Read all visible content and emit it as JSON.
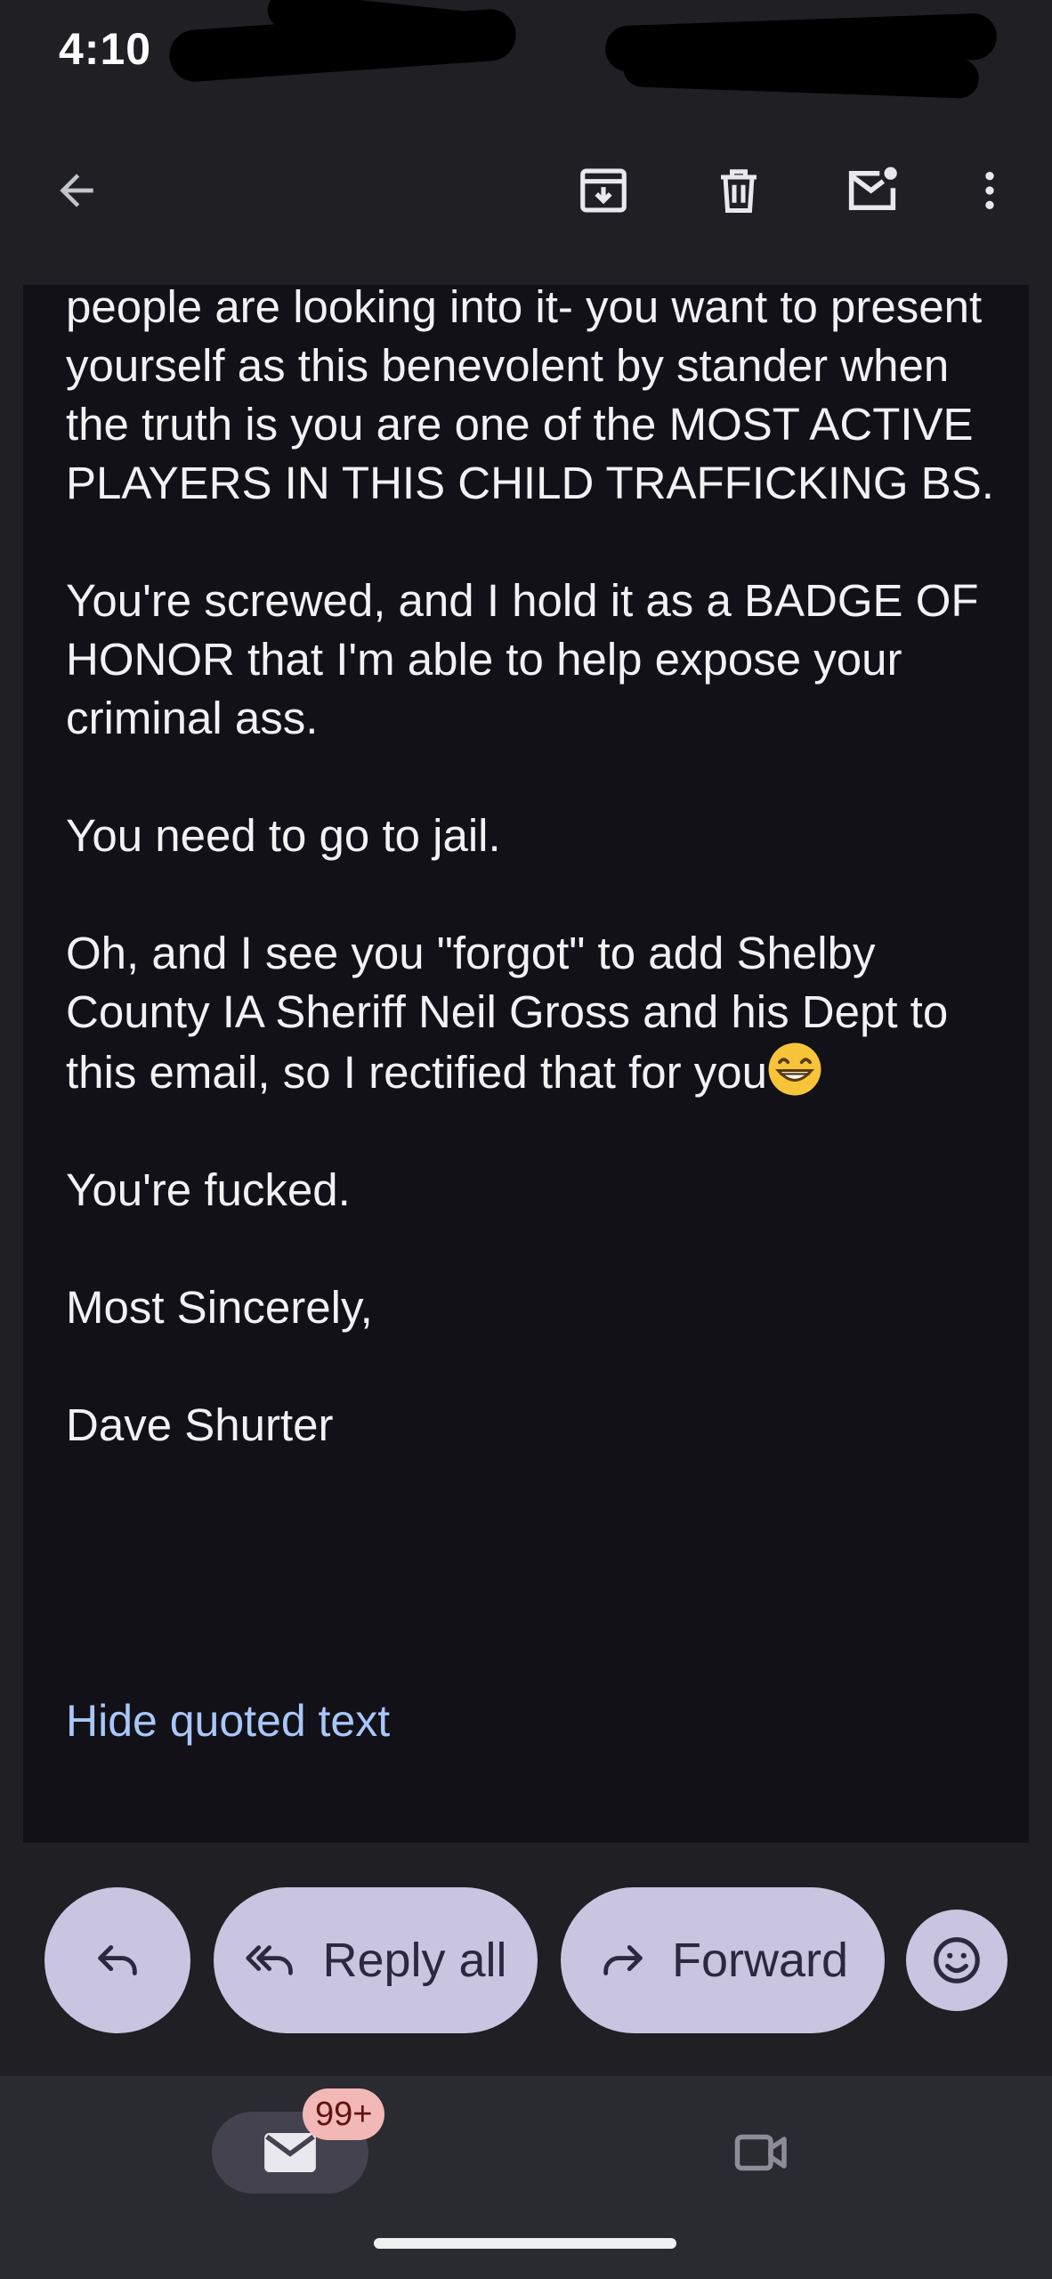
{
  "status_bar": {
    "time": "4:10"
  },
  "top_bar": {
    "back_icon": "arrow-back-icon",
    "archive_icon": "archive-icon",
    "delete_icon": "trash-icon",
    "mark_unread_icon": "mark-unread-icon",
    "more_icon": "more-vert-icon"
  },
  "message": {
    "paragraphs": [
      "people are looking into it- you want to present yourself as this benevolent by stander when the truth is you are one of the MOST ACTIVE PLAYERS IN THIS CHILD TRAFFICKING BS.",
      "You're screwed, and I hold it as a BADGE OF HONOR that I'm able to help expose your criminal ass.",
      "You need to go to jail.",
      "Oh, and I see you \"forgot\" to add Shelby County IA Sheriff Neil Gross and his Dept to this email, so I rectified that for you",
      "You're fucked.",
      "Most Sincerely,",
      "Dave Shurter"
    ],
    "emoji_icon": "grinning-face-emoji",
    "hide_quoted_label": "Hide quoted text"
  },
  "actions": {
    "reply_icon": "reply-icon",
    "reply_all_label": "Reply all",
    "forward_label": "Forward",
    "emoji_react_icon": "add-reaction-icon"
  },
  "bottom_nav": {
    "mail_icon": "mail-icon",
    "mail_badge": "99+",
    "meet_icon": "video-camera-icon"
  },
  "colors": {
    "background": "#1f1f24",
    "message_background": "#121117",
    "link": "#a8c7fa",
    "pill": "#c9c4df",
    "badge": "#f2b8b5"
  }
}
